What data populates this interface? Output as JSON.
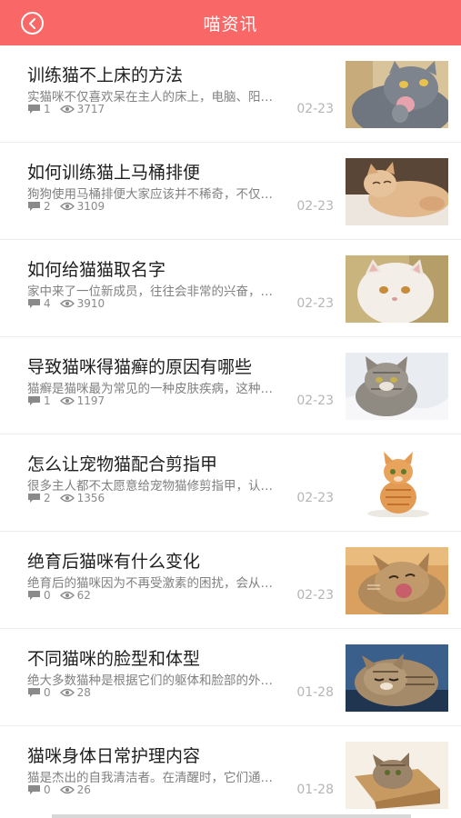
{
  "header": {
    "title": "喵资讯",
    "back_icon": "chevron-left-circle-icon",
    "color": "#fa6767"
  },
  "articles": [
    {
      "title": "训练猫不上床的方法",
      "summary": "实猫咪不仅喜欢呆在主人的床上，电脑、阳…",
      "comments": "1",
      "views": "3717",
      "date": "02-23",
      "image": "gray-cat-licking-paw"
    },
    {
      "title": "如何训练猫上马桶排便",
      "summary": "狗狗使用马桶排便大家应该并不稀奇，不仅…",
      "comments": "2",
      "views": "3109",
      "date": "02-23",
      "image": "orange-cat-lying"
    },
    {
      "title": "如何给猫猫取名字",
      "summary": "家中来了一位新成员，往往会非常的兴奋，…",
      "comments": "4",
      "views": "3910",
      "date": "02-23",
      "image": "white-persian-cat"
    },
    {
      "title": "导致猫咪得猫癣的原因有哪些",
      "summary": "猫癣是猫咪最为常见的一种皮肤疾病，这种…",
      "comments": "1",
      "views": "1197",
      "date": "02-23",
      "image": "tabby-cat-on-blanket"
    },
    {
      "title": "怎么让宠物猫配合剪指甲",
      "summary": "很多主人都不太愿意给宠物猫修剪指甲，认…",
      "comments": "2",
      "views": "1356",
      "date": "02-23",
      "image": "orange-tabby-kitten-sitting"
    },
    {
      "title": "绝育后猫咪有什么变化",
      "summary": "绝育后的猫咪因为不再受激素的困扰，会从…",
      "comments": "0",
      "views": "62",
      "date": "02-23",
      "image": "tabby-cat-yawning"
    },
    {
      "title": "不同猫咪的脸型和体型",
      "summary": "绝大多数猫种是根据它们的躯体和脸部的外…",
      "comments": "0",
      "views": "28",
      "date": "01-28",
      "image": "tabby-cat-sleeping"
    },
    {
      "title": "猫咪身体日常护理内容",
      "summary": "猫是杰出的自我清洁者。在清醒时，它们通…",
      "comments": "0",
      "views": "26",
      "date": "01-28",
      "image": "kitten-in-wooden-box"
    }
  ]
}
